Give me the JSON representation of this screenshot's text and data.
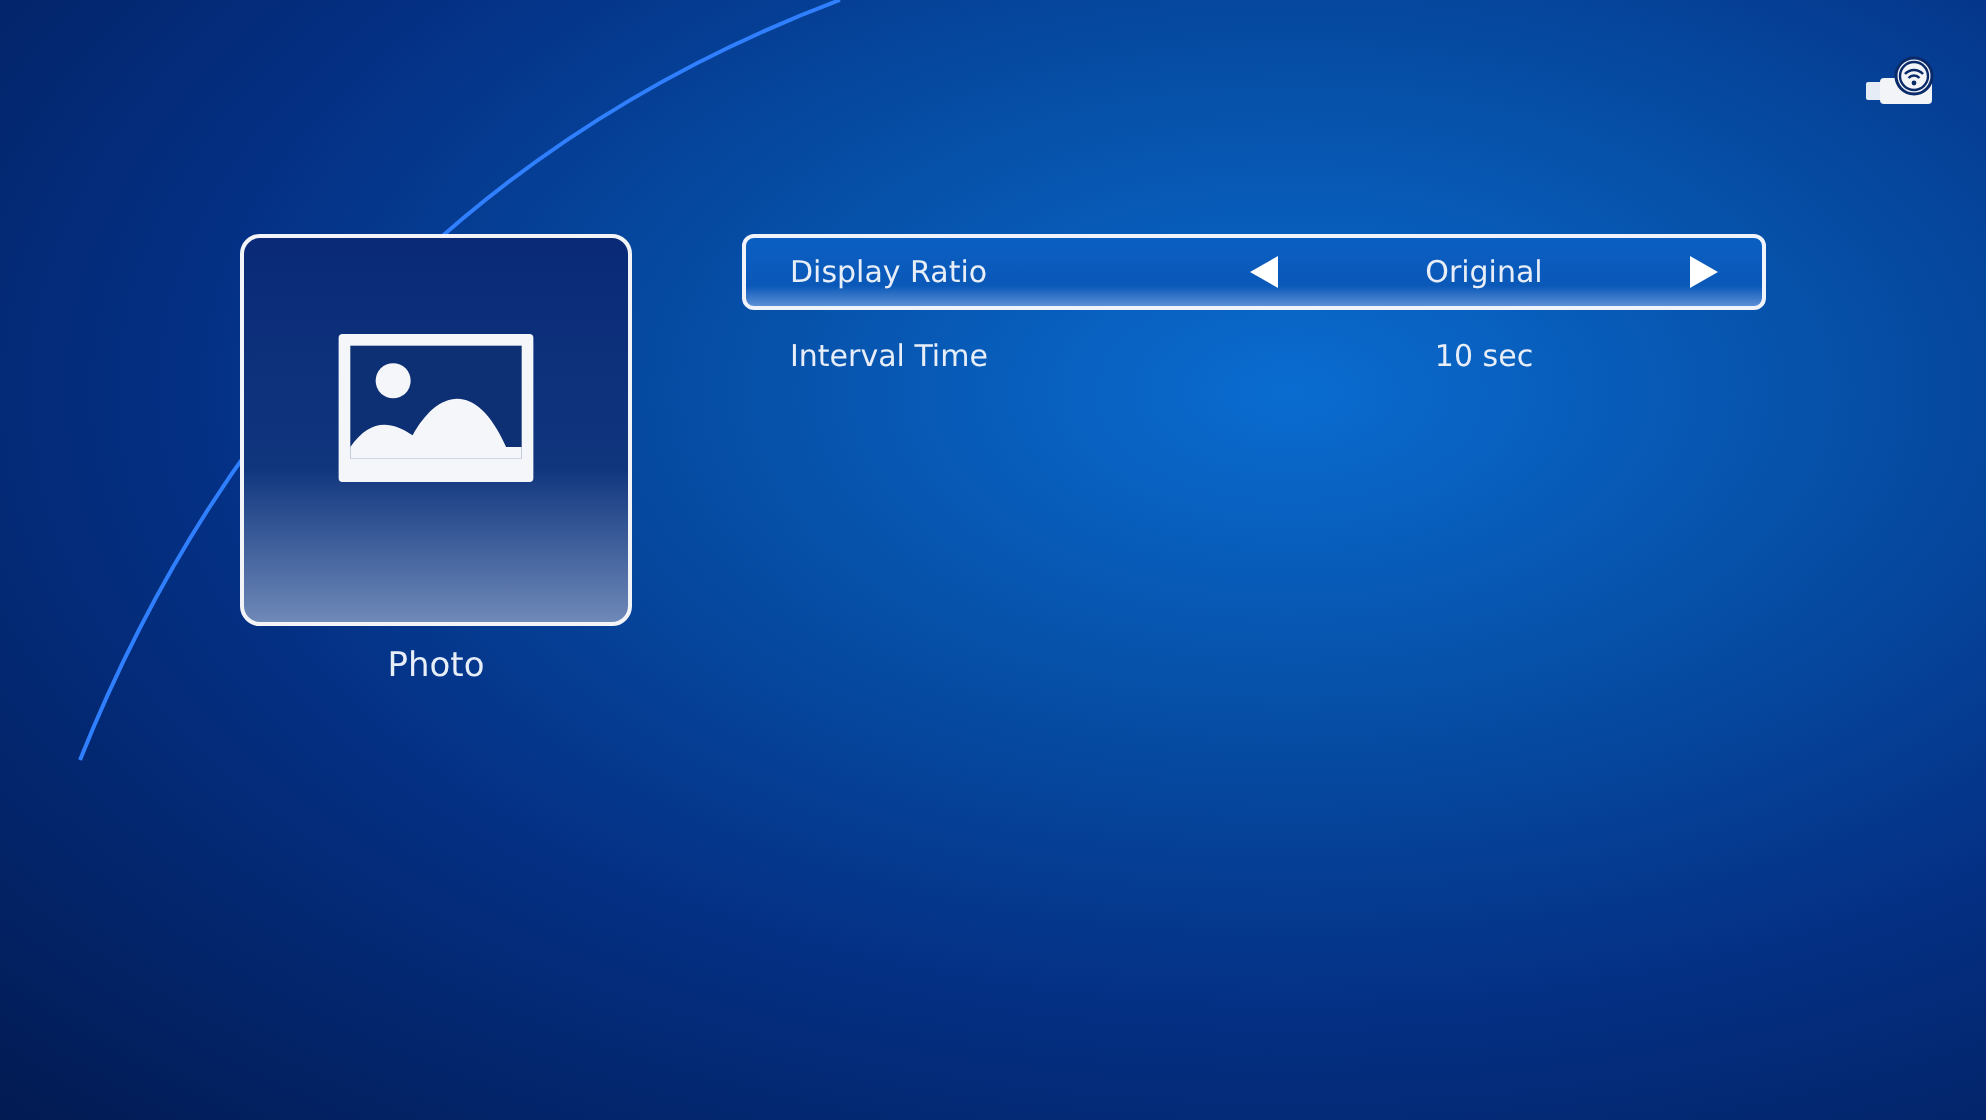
{
  "sidebar": {
    "items": [
      {
        "label": "Photo",
        "selected": true
      }
    ]
  },
  "settings": [
    {
      "label": "Display Ratio",
      "value": "Original",
      "selected": true
    },
    {
      "label": "Interval Time",
      "value": "10 sec",
      "selected": false
    }
  ]
}
